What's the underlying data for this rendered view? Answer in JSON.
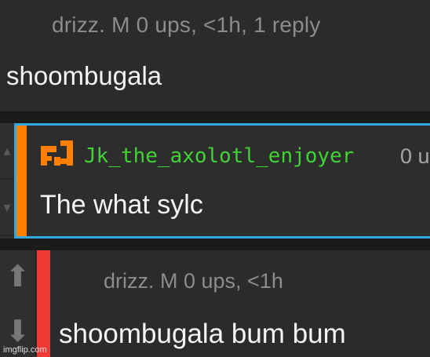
{
  "comments": [
    {
      "meta": "drizz.   M   0 ups, <1h, 1 reply",
      "body": "shoombugala"
    },
    {
      "username": "Jk_the_axolotl_enjoyer",
      "ups": "0 u",
      "body": "The what sylc",
      "accent_color": "#ff8000",
      "highlight_color": "#2ea8df",
      "username_color": "#41d336"
    },
    {
      "meta": "drizz.   M   0 ups, <1h",
      "body": "shoombugala bum bum",
      "accent_color": "#ef3a36"
    }
  ],
  "icons": {
    "upvote": "arrow-up-icon",
    "downvote": "arrow-down-icon"
  },
  "watermark": "imgflip.com"
}
